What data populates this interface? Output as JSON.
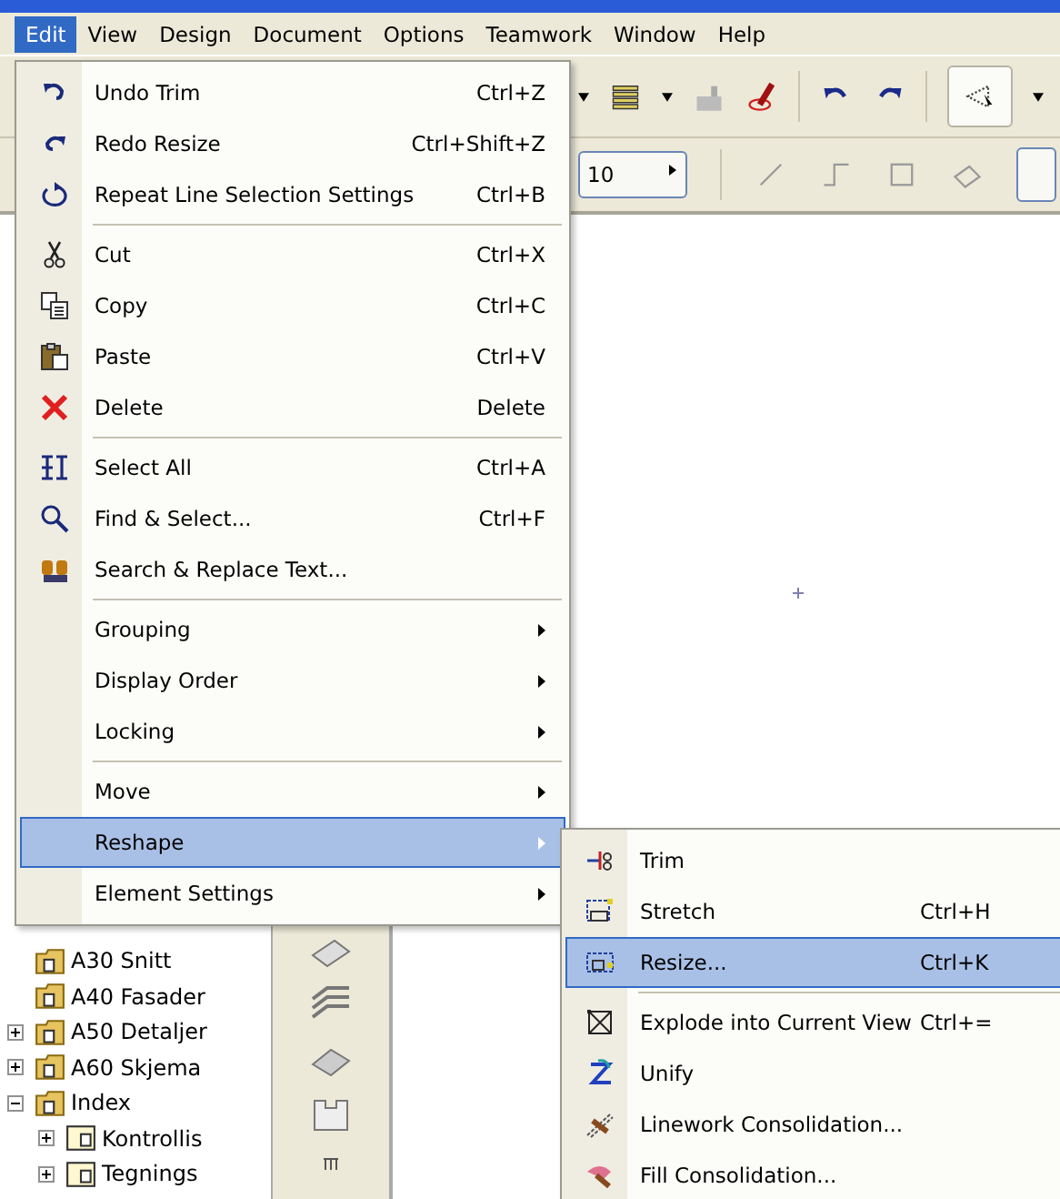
{
  "menu_bar": [
    {
      "label": "Edit",
      "selected": true
    },
    {
      "label": "View",
      "selected": false
    },
    {
      "label": "Design",
      "selected": false
    },
    {
      "label": "Document",
      "selected": false
    },
    {
      "label": "Options",
      "selected": false
    },
    {
      "label": "Teamwork",
      "selected": false
    },
    {
      "label": "Window",
      "selected": false
    },
    {
      "label": "Help",
      "selected": false
    }
  ],
  "toolbar": {
    "field_value": "10"
  },
  "tree": [
    {
      "label": "A30 Snitt"
    },
    {
      "label": "A40 Fasader"
    },
    {
      "label": "A50 Detaljer",
      "expanded": false
    },
    {
      "label": "A60 Skjema",
      "expanded": false
    },
    {
      "label": "Index",
      "expanded": true,
      "children": [
        {
          "label": "Kontrollis",
          "expanded": false
        },
        {
          "label": "Tegnings",
          "expanded": false
        }
      ]
    }
  ],
  "edit_menu": [
    [
      {
        "label": "Undo Trim",
        "shortcut": "Ctrl+Z",
        "submenu": false,
        "selected": false
      },
      {
        "label": "Redo Resize",
        "shortcut": "Ctrl+Shift+Z",
        "submenu": false,
        "selected": false
      },
      {
        "label": "Repeat Line Selection Settings",
        "shortcut": "Ctrl+B",
        "submenu": false,
        "selected": false
      }
    ],
    [
      {
        "label": "Cut",
        "shortcut": "Ctrl+X",
        "submenu": false,
        "selected": false
      },
      {
        "label": "Copy",
        "shortcut": "Ctrl+C",
        "submenu": false,
        "selected": false
      },
      {
        "label": "Paste",
        "shortcut": "Ctrl+V",
        "submenu": false,
        "selected": false
      },
      {
        "label": "Delete",
        "shortcut": "Delete",
        "submenu": false,
        "selected": false
      }
    ],
    [
      {
        "label": "Select All",
        "shortcut": "Ctrl+A",
        "submenu": false,
        "selected": false
      },
      {
        "label": "Find & Select...",
        "shortcut": "Ctrl+F",
        "submenu": false,
        "selected": false
      },
      {
        "label": "Search & Replace Text...",
        "submenu": false,
        "selected": false
      }
    ],
    [
      {
        "label": "Grouping",
        "submenu": true,
        "selected": false
      },
      {
        "label": "Display Order",
        "submenu": true,
        "selected": false
      },
      {
        "label": "Locking",
        "submenu": true,
        "selected": false
      }
    ],
    [
      {
        "label": "Move",
        "submenu": true,
        "selected": false
      },
      {
        "label": "Reshape",
        "submenu": true,
        "selected": true
      },
      {
        "label": "Element Settings",
        "submenu": true,
        "selected": false
      }
    ]
  ],
  "reshape_submenu": [
    [
      {
        "label": "Trim",
        "selected": false
      },
      {
        "label": "Stretch",
        "shortcut": "Ctrl+H",
        "selected": false
      },
      {
        "label": "Resize...",
        "shortcut": "Ctrl+K",
        "selected": true
      }
    ],
    [
      {
        "label": "Explode into Current View",
        "shortcut": "Ctrl+=",
        "selected": false
      },
      {
        "label": "Unify",
        "selected": false
      },
      {
        "label": "Linework Consolidation...",
        "selected": false
      },
      {
        "label": "Fill Consolidation...",
        "selected": false
      }
    ]
  ]
}
